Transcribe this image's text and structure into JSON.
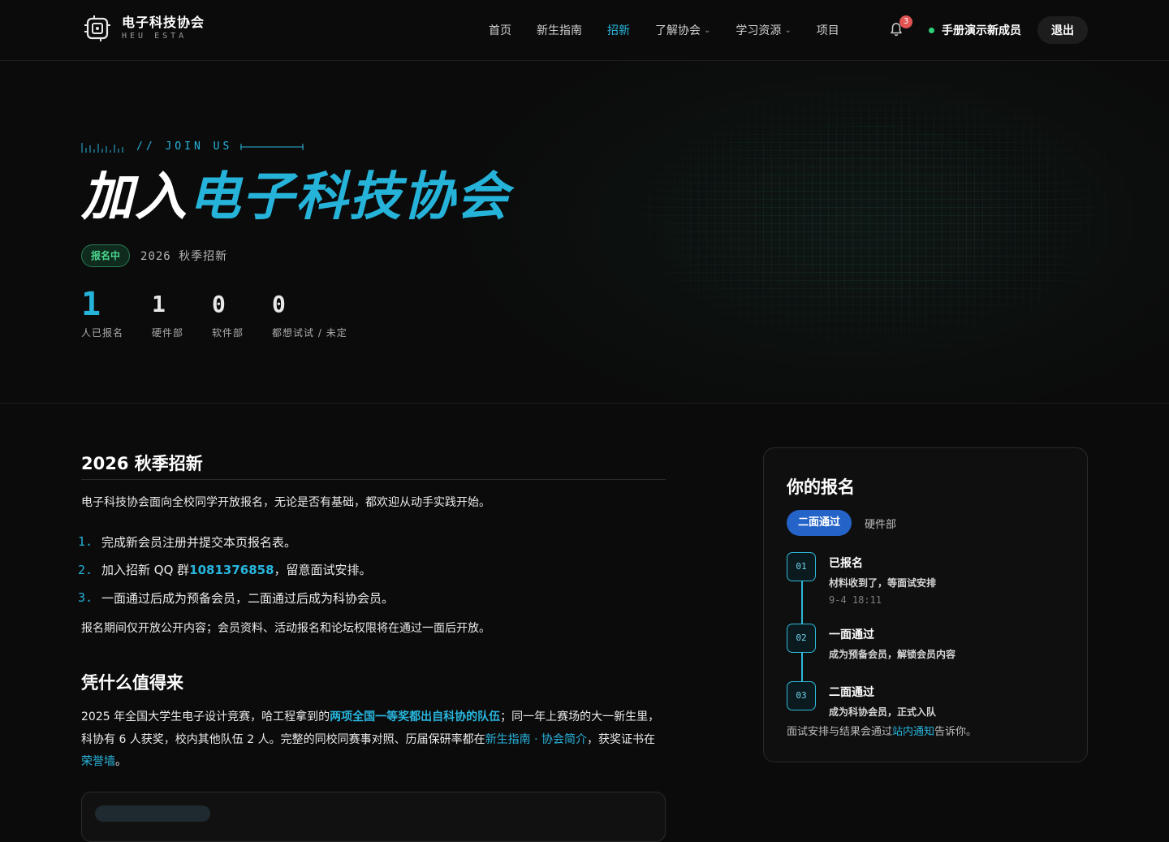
{
  "nav": {
    "logo_title": "电子科技协会",
    "logo_sub": "HEU ESTA",
    "links": [
      {
        "label": "首页"
      },
      {
        "label": "新生指南"
      },
      {
        "label": "招新"
      },
      {
        "label": "了解协会"
      },
      {
        "label": "学习资源"
      },
      {
        "label": "项目"
      }
    ],
    "active_index": 2,
    "notification_count": "3",
    "user_name": "手册演示新成员",
    "logout_label": "退出"
  },
  "hero": {
    "eyebrow": "// JOIN US",
    "title_white": "加入",
    "title_cyan": "电子科技协会",
    "status_pill": "报名中",
    "season": "2026 秋季招新",
    "stats": [
      {
        "value": "1",
        "label": "人已报名"
      },
      {
        "value": "1",
        "label": "硬件部"
      },
      {
        "value": "0",
        "label": "软件部"
      },
      {
        "value": "0",
        "label": "都想试试 / 未定"
      }
    ]
  },
  "main": {
    "section1_title": "2026 秋季招新",
    "intro": "电子科技协会面向全校同学开放报名，无论是否有基础，都欢迎从动手实践开始。",
    "steps": [
      {
        "num": "1.",
        "text": "完成新会员注册并提交本页报名表。"
      },
      {
        "num": "2.",
        "text_pre": "加入招新 QQ 群 ",
        "qq": "1081376858",
        "text_post": "，留意面试安排。"
      },
      {
        "num": "3.",
        "text": "一面通过后成为预备会员，二面通过后成为科协会员。"
      }
    ],
    "notice": "报名期间仅开放公开内容；会员资料、活动报名和论坛权限将在通过一面后开放。",
    "section2_title": "凭什么值得来",
    "why_1": "2025 年全国大学生电子设计竞赛，哈工程拿到的",
    "why_hl": "两项全国一等奖都出自科协的队伍",
    "why_2": "；同一年上赛场的大一新生里，科协有 6 人获奖，校内其他队伍 2 人。完整的同校同赛事对照、历届保研率都在",
    "why_link1": "新生指南 · 协会简介",
    "why_3": "，获奖证书在",
    "why_link2": "荣誉墙",
    "why_4": "。"
  },
  "card": {
    "title": "你的报名",
    "status_chip": "二面通过",
    "department": "硬件部",
    "timeline": [
      {
        "num": "01",
        "title": "已报名",
        "desc": "材料收到了，等面试安排",
        "time": "9-4 18:11"
      },
      {
        "num": "02",
        "title": "一面通过",
        "desc": "成为预备会员，解锁会员内容",
        "time": ""
      },
      {
        "num": "03",
        "title": "二面通过",
        "desc": "成为科协会员，正式入队",
        "time": ""
      }
    ],
    "foot_pre": "面试安排与结果会通过",
    "foot_link": "站内通知",
    "foot_post": "告诉你。"
  }
}
